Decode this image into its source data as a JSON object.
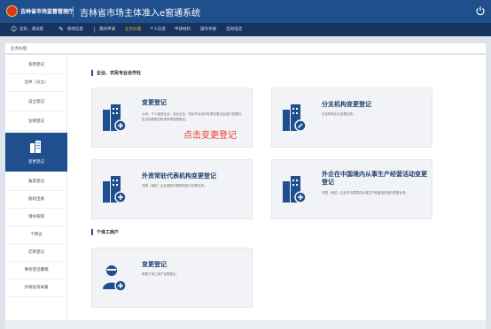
{
  "header": {
    "agency": "吉林省市场监督管理厅",
    "system": "吉林省市场主体准入e窗通系统"
  },
  "nav": {
    "welcome": "您好，测试者",
    "items": [
      "修改信息",
      "我的申请",
      "业务办理",
      "个人信息",
      "申请材料",
      "操作手册",
      "咨询电话"
    ],
    "active_index": 2
  },
  "breadcrumb": "业务办理",
  "sidebar": {
    "items": [
      "名称登记",
      "合并（分立）",
      "设立登记",
      "注销登记",
      "变更登记",
      "备案登记",
      "股权出质",
      "增补照照",
      "个转企",
      "迁移登记",
      "事务登记撤销",
      "外商投资采集"
    ],
    "active_index": 4
  },
  "sections": [
    {
      "title": "企业、农民专业合作社"
    },
    {
      "title": "个体工商户"
    }
  ],
  "cards": [
    {
      "title": "变更登记",
      "desc": "公司、个人独资企业、合伙企业、农民专业合作社等在登记后进行变更时，应当向原登记机关申请变更登记。",
      "hint": "点击变更登记"
    },
    {
      "title": "分支机构变更登记",
      "desc": "分支机构企业变更业务。"
    },
    {
      "title": "外资常驻代表机构变更登记",
      "desc": "外国（地区）企业常驻代表机构进行变更业务。"
    },
    {
      "title": "外企在中国境内从事生产经营活动变更登记",
      "desc": "外国（地区）企业在中国境内从事生产经营活动进行变更业务。"
    },
    {
      "title": "变更登记",
      "desc": "所属个体工商户变更登记。"
    }
  ],
  "colors": {
    "brand": "#1f4f8d",
    "nav": "#17345e",
    "active": "#f5a623",
    "hint": "#e83a2f"
  }
}
